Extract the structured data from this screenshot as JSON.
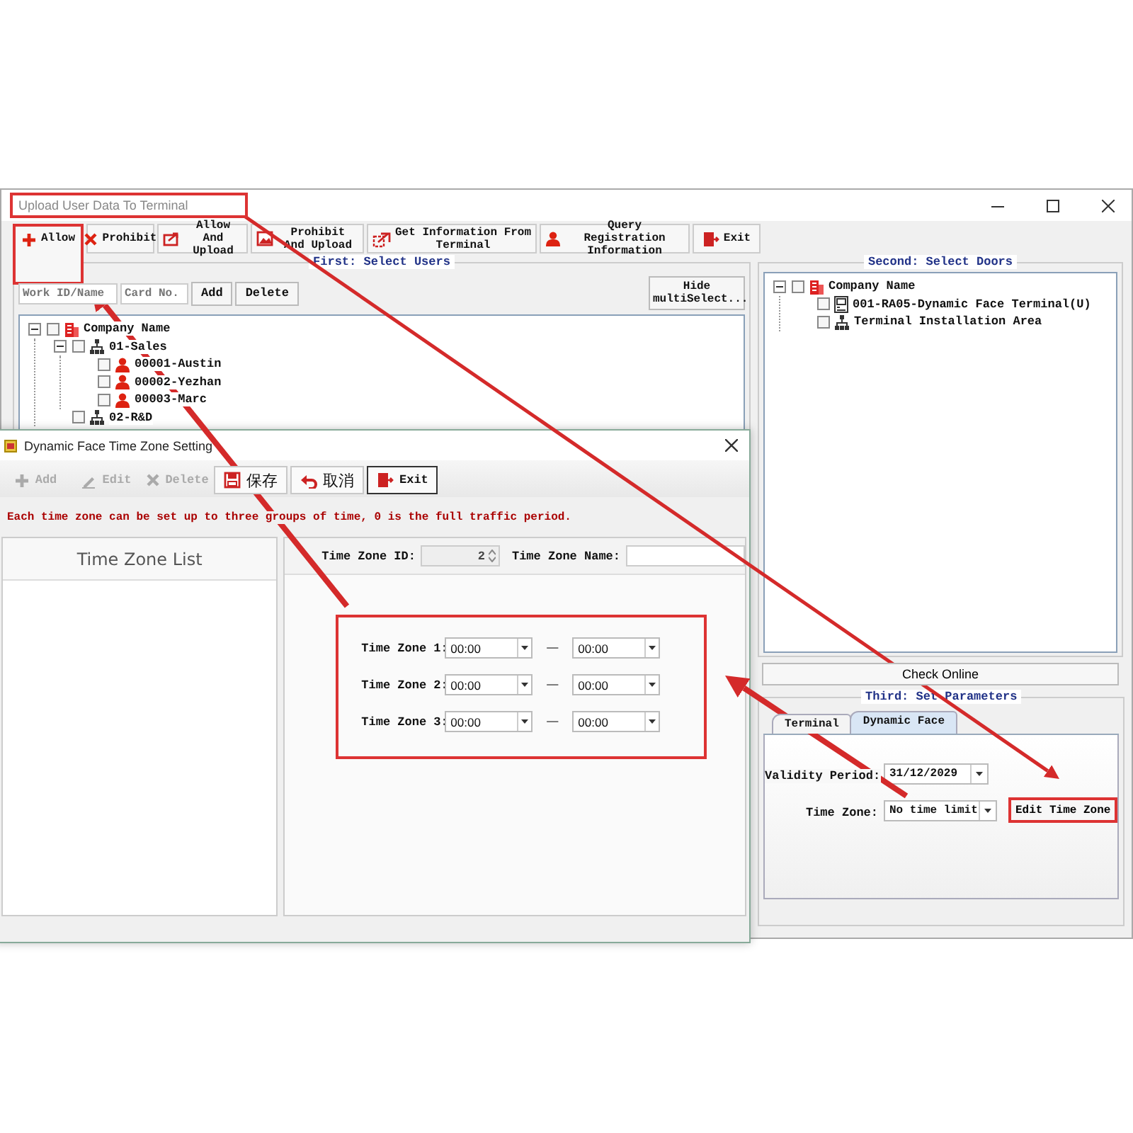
{
  "main_window": {
    "title": "Upload User Data To Terminal",
    "title_highlighted": true,
    "toolbar": [
      {
        "label": "Allow",
        "highlighted": true
      },
      {
        "label": "Prohibit",
        "highlighted": false
      },
      {
        "label": "Allow And Upload",
        "highlighted": false
      },
      {
        "label": "Prohibit And Upload",
        "highlighted": false
      },
      {
        "label": "Get Information From Terminal",
        "highlighted": false
      },
      {
        "label": "Query Registration Information",
        "highlighted": false
      },
      {
        "label": "Exit",
        "highlighted": false
      }
    ],
    "users_panel": {
      "title": "First: Select Users",
      "work_id_field": {
        "placeholder": "Work ID/Name"
      },
      "card_field": {
        "placeholder": "Card No."
      },
      "buttons": [
        "Add",
        "Delete"
      ],
      "multiselect_button": "Hide multiSelect...",
      "tree": [
        {
          "label": "Company Name",
          "kind": "company",
          "checked": false,
          "expanded": true,
          "children": [
            {
              "label": "01-Sales",
              "kind": "department",
              "checked": false,
              "expanded": true,
              "children": [
                {
                  "label": "00001-Austin",
                  "kind": "person",
                  "checked": false
                },
                {
                  "label": "00002-Yezhan",
                  "kind": "person",
                  "checked": false
                },
                {
                  "label": "00003-Marc",
                  "kind": "person",
                  "checked": false
                }
              ]
            },
            {
              "label": "02-R&D",
              "kind": "department",
              "checked": false
            }
          ]
        }
      ]
    },
    "doors_panel": {
      "title": "Second: Select Doors",
      "tree": [
        {
          "label": "Company Name",
          "kind": "company",
          "checked": false,
          "expanded": true,
          "children": [
            {
              "label": "001-RA05-Dynamic Face Terminal(U)",
              "kind": "terminal",
              "checked": false
            },
            {
              "label": "Terminal Installation Area",
              "kind": "department",
              "checked": false
            }
          ]
        }
      ]
    },
    "check_online_button": "Check Online",
    "parameters_panel": {
      "title": "Third: Set Parameters",
      "tabs": [
        {
          "label": "Terminal",
          "selected": false
        },
        {
          "label": "Dynamic Face",
          "selected": true
        }
      ],
      "validity_period": {
        "label": "Validity Period:",
        "value": "31/12/2029"
      },
      "time_zone": {
        "label": "Time Zone:",
        "value": "No time limit"
      },
      "edit_button": {
        "label": "Edit Time Zone",
        "highlighted": true
      }
    }
  },
  "dialog": {
    "title": "Dynamic Face Time Zone Setting",
    "toolbar": [
      {
        "label": "Add",
        "disabled": true,
        "focused": false
      },
      {
        "label": "Edit",
        "disabled": true,
        "focused": false
      },
      {
        "label": "Delete",
        "disabled": true,
        "focused": false
      },
      {
        "label": "保存",
        "disabled": false,
        "focused": false
      },
      {
        "label": "取消",
        "disabled": false,
        "focused": false
      },
      {
        "label": "Exit",
        "disabled": false,
        "focused": true
      }
    ],
    "message": "Each time zone can be set up to three groups of time, 0 is the full traffic period.",
    "list_title": "Time Zone List",
    "id_field": {
      "label": "Time Zone ID:",
      "value": "2"
    },
    "name_field": {
      "label": "Time Zone Name:"
    },
    "time_zones_highlighted": true,
    "time_zones": [
      {
        "label": "Time Zone 1:",
        "start": "00:00",
        "separator": "—",
        "end": "00:00"
      },
      {
        "label": "Time Zone 2:",
        "start": "00:00",
        "separator": "—",
        "end": "00:00"
      },
      {
        "label": "Time Zone 3:",
        "start": "00:00",
        "separator": "—",
        "end": "00:00"
      }
    ]
  },
  "arrows": [
    {
      "kind": "thick"
    },
    {
      "kind": "medium"
    },
    {
      "kind": "thick"
    }
  ]
}
